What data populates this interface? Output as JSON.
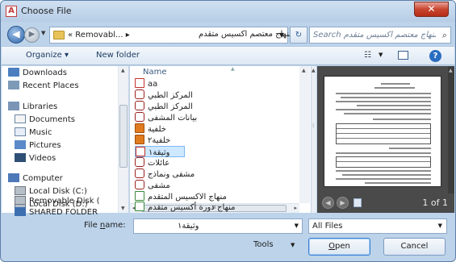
{
  "window": {
    "title": "Choose File",
    "app_icon_letter": "A",
    "close_glyph": "✕"
  },
  "address": {
    "part1": "« Removabl... ▸",
    "part2": "منهاج معتصم اكسيس متقدم",
    "search_placeholder": "Search منهاج معتصم اكسيس متقدم"
  },
  "toolbar": {
    "organize": "Organize ▾",
    "new_folder": "New folder"
  },
  "nav": {
    "items": [
      {
        "label": "Downloads",
        "icon": "downloads-icon"
      },
      {
        "label": "Recent Places",
        "icon": "recent-places-icon"
      },
      {
        "label": "Libraries",
        "icon": "libraries-icon"
      },
      {
        "label": "Documents",
        "icon": "documents-icon"
      },
      {
        "label": "Music",
        "icon": "music-icon"
      },
      {
        "label": "Pictures",
        "icon": "pictures-icon"
      },
      {
        "label": "Videos",
        "icon": "videos-icon"
      },
      {
        "label": "Computer",
        "icon": "computer-icon"
      },
      {
        "label": "Local Disk (C:)",
        "icon": "disk-icon"
      },
      {
        "label": "Local Disk (D:)",
        "icon": "disk-icon"
      },
      {
        "label": "Removable Disk (",
        "icon": "removable-disk-icon"
      },
      {
        "label": "SHARED FOLDER",
        "icon": "shared-folder-icon"
      }
    ]
  },
  "files": {
    "column_name": "Name",
    "items": [
      {
        "name": "aa",
        "icon": "pdf-icon"
      },
      {
        "name": "المركز الطبي",
        "icon": "acrobat-icon"
      },
      {
        "name": "المركز الطبي",
        "icon": "acrobat-icon"
      },
      {
        "name": "بيانات المشفى",
        "icon": "acrobat-icon"
      },
      {
        "name": "خلفية",
        "icon": "image-icon"
      },
      {
        "name": "خلفية٢",
        "icon": "image-icon"
      },
      {
        "name": "وثيقة١",
        "icon": "pdf-icon",
        "selected": true
      },
      {
        "name": "عائلات",
        "icon": "acrobat-icon"
      },
      {
        "name": "مشفى ونماذج",
        "icon": "acrobat-icon"
      },
      {
        "name": "مشفى",
        "icon": "acrobat-icon"
      },
      {
        "name": "منهاج الاكسيس المتقدم",
        "icon": "document-icon"
      },
      {
        "name": "منهاج دورة أكسيس متقدم",
        "icon": "document-icon"
      }
    ],
    "hscroll_grip": "III"
  },
  "preview": {
    "page_count": "1 of 1"
  },
  "bottom": {
    "filename_label_prefix": "File ",
    "filename_label_underlined": "n",
    "filename_label_suffix": "ame:",
    "filename_value": "وثيقة١",
    "filetype_value": "All Files",
    "tools_label": "Tools",
    "open_label_underlined": "O",
    "open_label_rest": "pen",
    "cancel_label": "Cancel"
  }
}
